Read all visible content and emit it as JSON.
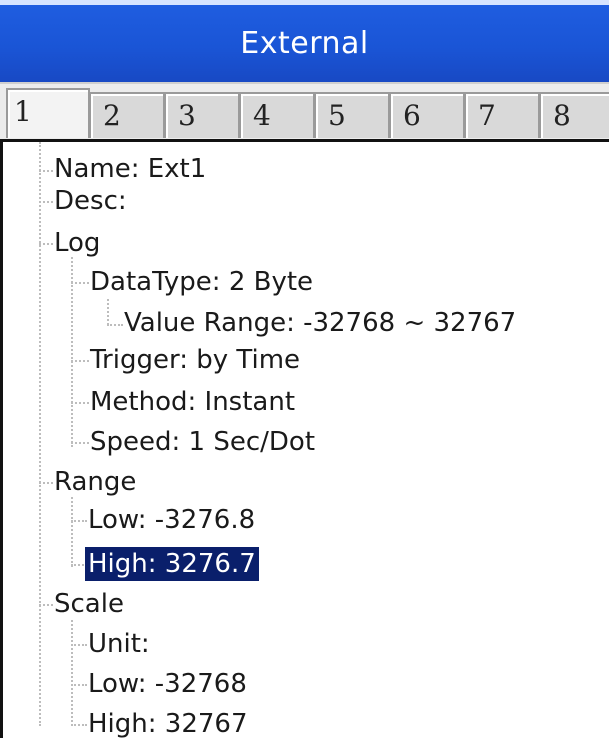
{
  "window": {
    "title": "External"
  },
  "tabs": [
    "1",
    "2",
    "3",
    "4",
    "5",
    "6",
    "7",
    "8"
  ],
  "tree": {
    "name": "Name: Ext1",
    "desc": "Desc:",
    "log": {
      "label": "Log",
      "datatype": "DataType: 2 Byte",
      "value_range": "Value Range: -32768 ~ 32767",
      "trigger": "Trigger: by Time",
      "method": "Method: Instant",
      "speed": "Speed: 1 Sec/Dot"
    },
    "range": {
      "label": "Range",
      "low": "Low: -3276.8",
      "high": "High: 3276.7"
    },
    "scale": {
      "label": "Scale",
      "unit": "Unit:",
      "low": "Low: -32768",
      "high": "High: 32767"
    }
  },
  "selected_item": "High: 3276.7"
}
